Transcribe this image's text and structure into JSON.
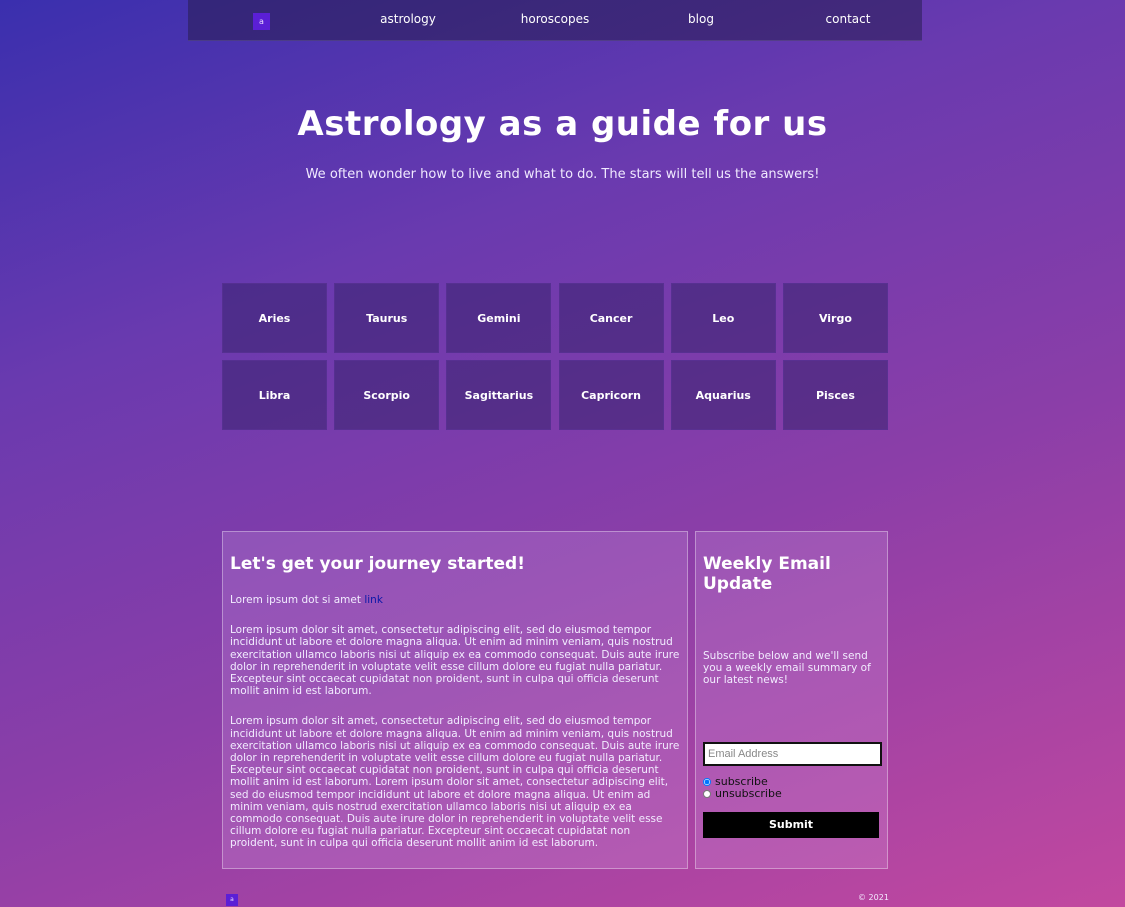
{
  "nav": {
    "logo": "a",
    "items": [
      "astrology",
      "horoscopes",
      "blog",
      "contact"
    ]
  },
  "hero": {
    "title": "Astrology as a guide for us",
    "subtitle": "We often wonder how to live and what to do. The stars will tell us the answers!"
  },
  "signs": [
    "Aries",
    "Taurus",
    "Gemini",
    "Cancer",
    "Leo",
    "Virgo",
    "Libra",
    "Scorpio",
    "Sagittarius",
    "Capricorn",
    "Aquarius",
    "Pisces"
  ],
  "journey": {
    "title": "Let's get your journey started!",
    "lead_text": "Lorem ipsum dot si amet ",
    "lead_link": "link",
    "para1": "Lorem ipsum dolor sit amet, consectetur adipiscing elit, sed do eiusmod tempor incididunt ut labore et dolore magna aliqua. Ut enim ad minim veniam, quis nostrud exercitation ullamco laboris nisi ut aliquip ex ea commodo consequat. Duis aute irure dolor in reprehenderit in voluptate velit esse cillum dolore eu fugiat nulla pariatur. Excepteur sint occaecat cupidatat non proident, sunt in culpa qui officia deserunt mollit anim id est laborum.",
    "para2": "Lorem ipsum dolor sit amet, consectetur adipiscing elit, sed do eiusmod tempor incididunt ut labore et dolore magna aliqua. Ut enim ad minim veniam, quis nostrud exercitation ullamco laboris nisi ut aliquip ex ea commodo consequat. Duis aute irure dolor in reprehenderit in voluptate velit esse cillum dolore eu fugiat nulla pariatur. Excepteur sint occaecat cupidatat non proident, sunt in culpa qui officia deserunt mollit anim id est laborum. Lorem ipsum dolor sit amet, consectetur adipiscing elit, sed do eiusmod tempor incididunt ut labore et dolore magna aliqua. Ut enim ad minim veniam, quis nostrud exercitation ullamco laboris nisi ut aliquip ex ea commodo consequat. Duis aute irure dolor in reprehenderit in voluptate velit esse cillum dolore eu fugiat nulla pariatur. Excepteur sint occaecat cupidatat non proident, sunt in culpa qui officia deserunt mollit anim id est laborum."
  },
  "newsletter": {
    "title": "Weekly Email Update",
    "text": "Subscribe below and we'll send you a weekly email summary of our latest news!",
    "email_placeholder": "Email Address",
    "email_value": "",
    "subscribe_label": "subscribe",
    "unsubscribe_label": "unsubscribe",
    "selected": "subscribe",
    "submit_label": "Submit"
  },
  "footer": {
    "logo": "a",
    "copyright": "© 2021"
  }
}
